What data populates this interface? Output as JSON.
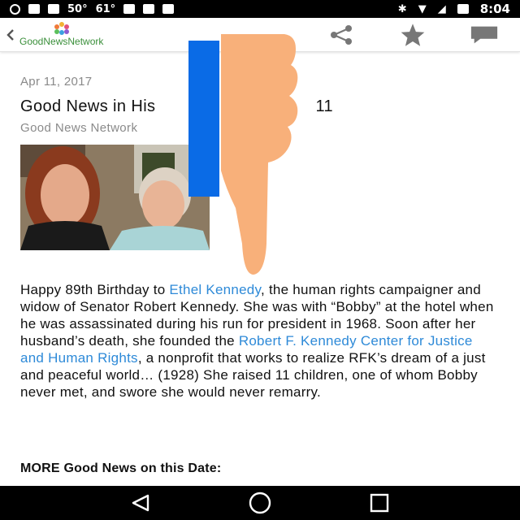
{
  "status_bar": {
    "temp1": "50°",
    "temp2": "61°",
    "time": "8:04"
  },
  "toolbar": {
    "logo_text": "GoodNewsNetwork",
    "icons": [
      "back-icon",
      "share-icon",
      "star-icon",
      "comment-icon"
    ]
  },
  "article": {
    "date": "Apr 11, 2017",
    "title": "Good News in His",
    "title_tail": "11",
    "source": "Good News Network",
    "p1": "Happy 89th Birthday to ",
    "link1": "Ethel Kennedy",
    "p2": ", the human rights campaigner and widow of Senator Robert Kennedy. She was with “Bobby” at the hotel when he was assassinated during his run for president in 1968. Soon after her husband’s death, she founded the ",
    "link2": "Robert F. Kennedy Center for Justice and Human Rights",
    "p3": ", a nonprofit that works to realize RFK’s dream of a just and peaceful world… (1928) She raised 11 children, one of whom Bobby never met, and swore she would never remarry.",
    "more_heading": "MORE Good News on this Date:"
  },
  "colors": {
    "link": "#2e8ad8",
    "meta_gray": "#8a8a8a",
    "overlay_blue": "#0a6be6",
    "overlay_skin": "#f8b07a"
  },
  "nav_bar": {
    "icons": [
      "back-triangle-icon",
      "home-circle-icon",
      "recents-square-icon"
    ]
  }
}
